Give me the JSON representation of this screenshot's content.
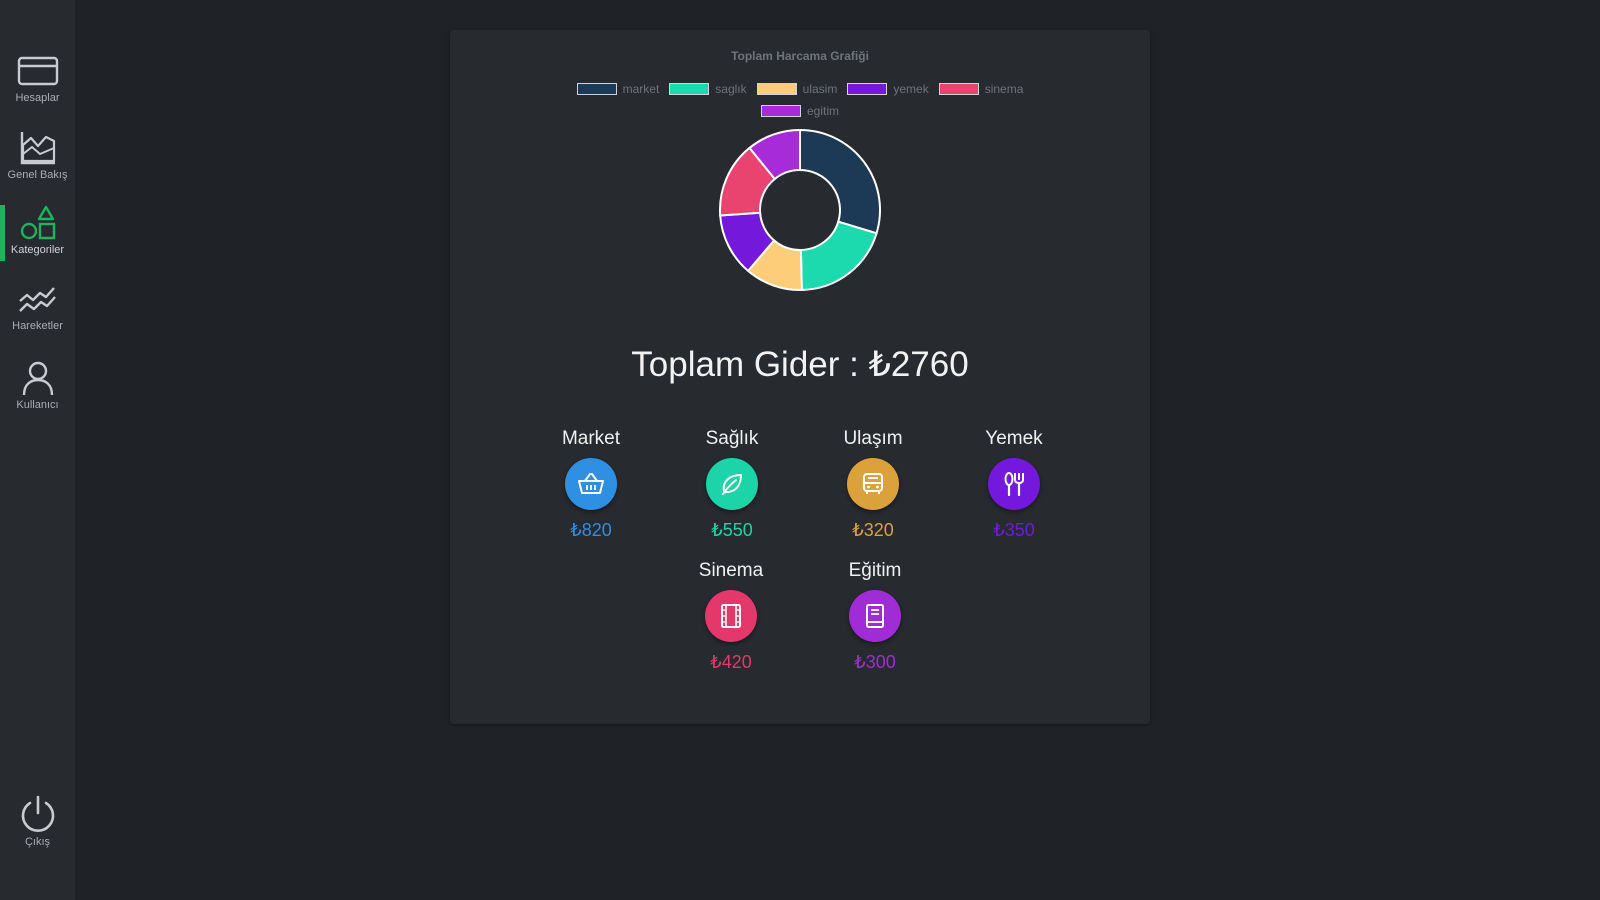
{
  "sidebar": {
    "items": [
      {
        "label": "Hesaplar",
        "icon": "credit-card-icon"
      },
      {
        "label": "Genel Bakış",
        "icon": "area-chart-icon"
      },
      {
        "label": "Kategoriler",
        "icon": "shapes-icon",
        "active": true
      },
      {
        "label": "Hareketler",
        "icon": "trend-lines-icon"
      },
      {
        "label": "Kullanıcı",
        "icon": "user-icon"
      }
    ],
    "logout": {
      "label": "Çıkış",
      "icon": "power-icon"
    },
    "accent": "#1fb35b"
  },
  "chart_data": {
    "type": "pie",
    "variant": "doughnut",
    "title": "Toplam Harcama Grafiği",
    "labels": [
      "market",
      "saglık",
      "ulasim",
      "yemek",
      "sinema",
      "egitim"
    ],
    "values": [
      820,
      550,
      320,
      350,
      420,
      300
    ],
    "colors": [
      "#1c3a55",
      "#1dd9ae",
      "#fdcd7a",
      "#7419dc",
      "#e9436f",
      "#a72bd8"
    ],
    "legend_position": "top"
  },
  "summary": {
    "total_label": "Toplam Gider : ₺2760"
  },
  "categories": [
    {
      "name": "Market",
      "amount": "₺820",
      "color": "#2e8fe3",
      "icon": "basket-icon"
    },
    {
      "name": "Sağlık",
      "amount": "₺550",
      "color": "#1dd4a8",
      "icon": "leaf-icon"
    },
    {
      "name": "Ulaşım",
      "amount": "₺320",
      "color": "#dba13a",
      "icon": "bus-icon"
    },
    {
      "name": "Yemek",
      "amount": "₺350",
      "color": "#7418dd",
      "icon": "fork-knife-icon"
    },
    {
      "name": "Sinema",
      "amount": "₺420",
      "color": "#e4386a",
      "icon": "film-icon"
    },
    {
      "name": "Eğitim",
      "amount": "₺300",
      "color": "#a02cd6",
      "icon": "book-icon"
    }
  ]
}
